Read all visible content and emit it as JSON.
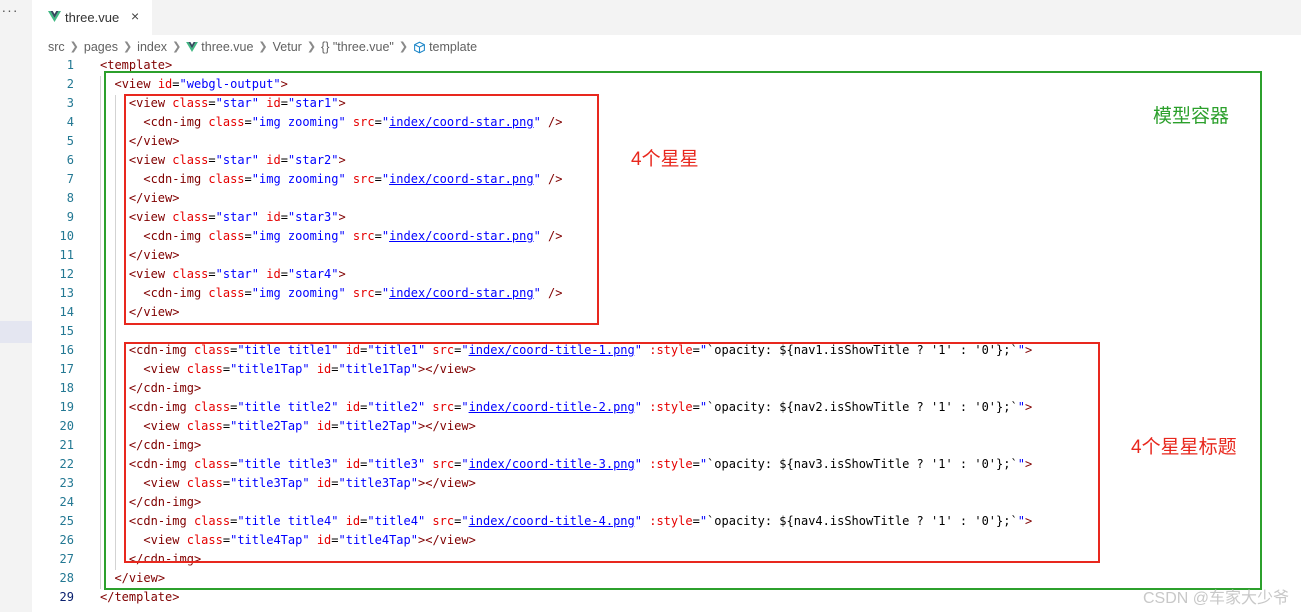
{
  "tab": {
    "title": "three.vue",
    "close": "×"
  },
  "breadcrumb": [
    "src",
    "pages",
    "index",
    "three.vue",
    "Vetur",
    "{} \"three.vue\"",
    "template"
  ],
  "annotations": {
    "model_container": "模型容器",
    "four_stars": "4个星星",
    "four_star_titles": "4个星星标题"
  },
  "colors": {
    "green_box": "#2ca02c",
    "red_box": "#e8281e",
    "tag": "#800000",
    "attr": "#e50000",
    "string": "#0000ff",
    "line_number": "#237893"
  },
  "watermark": "CSDN @车家大少爷",
  "lines": [
    "<template>",
    "  <view id=\"webgl-output\">",
    "    <view class=\"star\" id=\"star1\">",
    "      <cdn-img class=\"img zooming\" src=\"index/coord-star.png\" />",
    "    </view>",
    "    <view class=\"star\" id=\"star2\">",
    "      <cdn-img class=\"img zooming\" src=\"index/coord-star.png\" />",
    "    </view>",
    "    <view class=\"star\" id=\"star3\">",
    "      <cdn-img class=\"img zooming\" src=\"index/coord-star.png\" />",
    "    </view>",
    "    <view class=\"star\" id=\"star4\">",
    "      <cdn-img class=\"img zooming\" src=\"index/coord-star.png\" />",
    "    </view>",
    "",
    "    <cdn-img class=\"title title1\" id=\"title1\" src=\"index/coord-title-1.png\" :style=\"`opacity: ${nav1.isShowTitle ? '1' : '0'};`\">",
    "      <view class=\"title1Tap\" id=\"title1Tap\"></view>",
    "    </cdn-img>",
    "    <cdn-img class=\"title title2\" id=\"title2\" src=\"index/coord-title-2.png\" :style=\"`opacity: ${nav2.isShowTitle ? '1' : '0'};`\">",
    "      <view class=\"title2Tap\" id=\"title2Tap\"></view>",
    "    </cdn-img>",
    "    <cdn-img class=\"title title3\" id=\"title3\" src=\"index/coord-title-3.png\" :style=\"`opacity: ${nav3.isShowTitle ? '1' : '0'};`\">",
    "      <view class=\"title3Tap\" id=\"title3Tap\"></view>",
    "    </cdn-img>",
    "    <cdn-img class=\"title title4\" id=\"title4\" src=\"index/coord-title-4.png\" :style=\"`opacity: ${nav4.isShowTitle ? '1' : '0'};`\">",
    "      <view class=\"title4Tap\" id=\"title4Tap\"></view>",
    "    </cdn-img>",
    "  </view>",
    "</template>"
  ],
  "current_line": 29
}
